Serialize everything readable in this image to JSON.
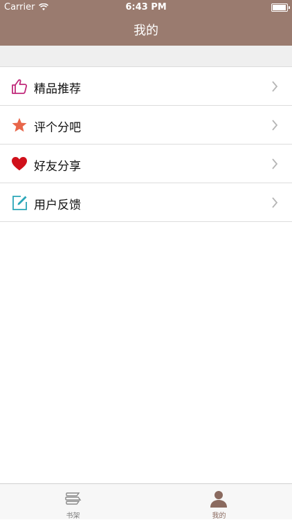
{
  "status_bar": {
    "carrier": "Carrier",
    "time": "6:43 PM"
  },
  "nav": {
    "title": "我的"
  },
  "menu": {
    "items": [
      {
        "label": "精品推荐",
        "icon": "thumbs-up-icon"
      },
      {
        "label": "评个分吧",
        "icon": "star-icon"
      },
      {
        "label": "好友分享",
        "icon": "heart-icon"
      },
      {
        "label": "用户反馈",
        "icon": "edit-icon"
      }
    ]
  },
  "tabbar": {
    "tabs": [
      {
        "label": "书架",
        "icon": "books-icon",
        "selected": false
      },
      {
        "label": "我的",
        "icon": "person-icon",
        "selected": true
      }
    ]
  },
  "colors": {
    "nav_background": "#9a7b6f",
    "accent": "#8a6a5f",
    "thumbs_up": "#c0287a",
    "star": "#e8664a",
    "heart": "#d0101a",
    "edit": "#2aa6b8"
  }
}
